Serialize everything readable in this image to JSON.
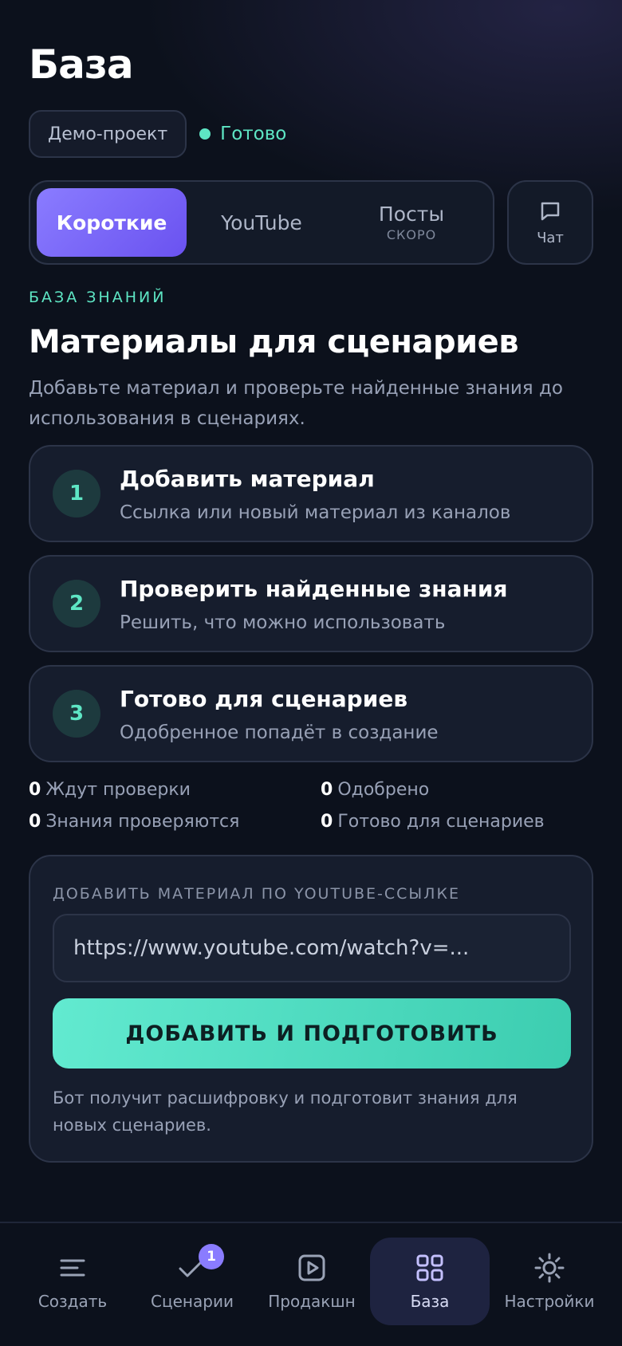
{
  "header": {
    "title": "База"
  },
  "project": {
    "name": "Демо-проект",
    "status": "Готово"
  },
  "tabs": [
    {
      "label": "Короткие",
      "sub": "",
      "active": true
    },
    {
      "label": "YouTube",
      "sub": ""
    },
    {
      "label": "Посты",
      "sub": "СКОРО"
    }
  ],
  "chat": {
    "label": "Чат",
    "icon": "chat-bubble-icon"
  },
  "section": {
    "eyebrow": "БАЗА ЗНАНИЙ",
    "title": "Материалы для сценариев",
    "lead": "Добавьте материал и проверьте найденные знания до использования в сценариях."
  },
  "steps": [
    {
      "num": "1",
      "title": "Добавить материал",
      "sub": "Ссылка или новый материал из каналов"
    },
    {
      "num": "2",
      "title": "Проверить найденные знания",
      "sub": "Решить, что можно использовать"
    },
    {
      "num": "3",
      "title": "Готово для сценариев",
      "sub": "Одобренное попадёт в создание"
    }
  ],
  "stats": [
    {
      "value": "0",
      "label": "Ждут проверки"
    },
    {
      "value": "0",
      "label": "Одобрено"
    },
    {
      "value": "0",
      "label": "Знания проверяются"
    },
    {
      "value": "0",
      "label": "Готово для сценариев"
    }
  ],
  "form": {
    "label": "ДОБАВИТЬ МАТЕРИАЛ ПО YOUTUBE-ССЫЛКЕ",
    "placeholder": "https://www.youtube.com/watch?v=...",
    "button": "ДОБАВИТЬ И ПОДГОТОВИТЬ",
    "note": "Бот получит расшифровку и подготовит знания для новых сценариев."
  },
  "nav": [
    {
      "label": "Создать",
      "icon": "create-lines-icon"
    },
    {
      "label": "Сценарии",
      "icon": "checkmark-icon",
      "badge": "1"
    },
    {
      "label": "Продакшн",
      "icon": "play-icon"
    },
    {
      "label": "База",
      "icon": "grid-icon",
      "active": true
    },
    {
      "label": "Настройки",
      "icon": "sun-settings-icon"
    }
  ],
  "colors": {
    "accent": "#5ee6c4",
    "primary": "#7c68f5",
    "background": "#0c111c"
  }
}
